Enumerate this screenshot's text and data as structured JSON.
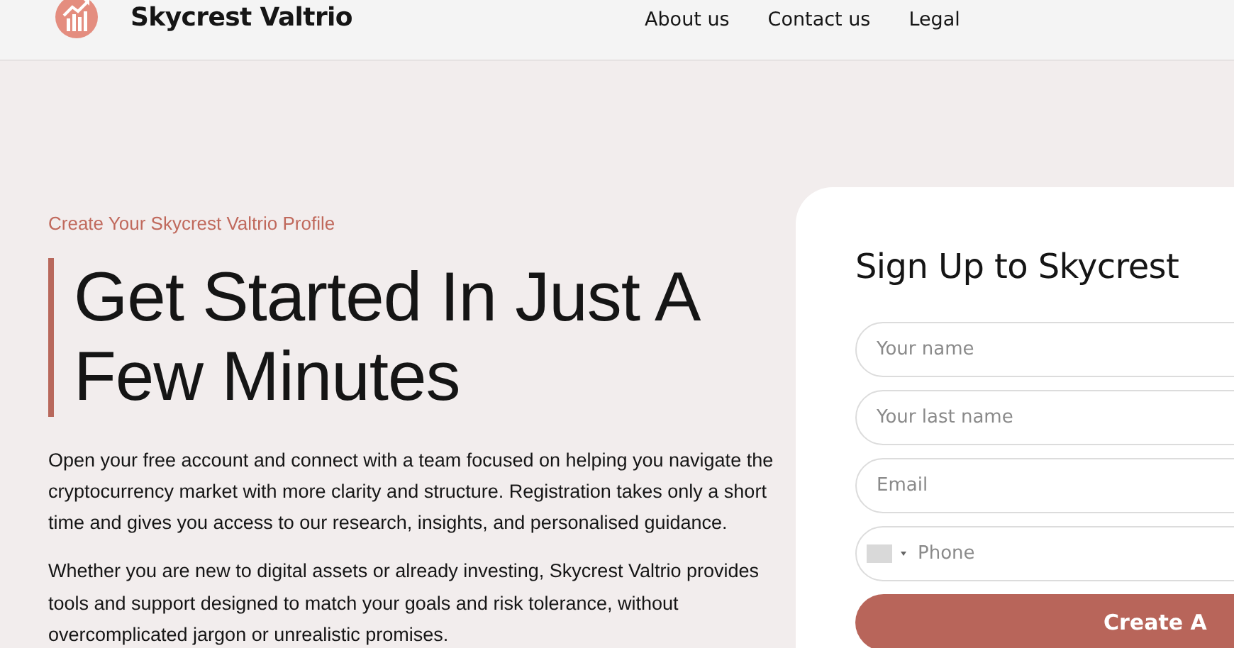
{
  "header": {
    "brand": "Skycrest Valtrio",
    "nav": [
      "About us",
      "Contact us",
      "Legal"
    ]
  },
  "hero": {
    "eyebrow": "Create Your Skycrest Valtrio Profile",
    "title": "Get Started In Just A Few Minutes",
    "paragraphs": [
      "Open your free account and connect with a team focused on helping you navigate the cryptocurrency market with more clarity and structure. Registration takes only a short time and gives you access to our research, insights, and personalised guidance.",
      "Whether you are new to digital assets or already investing, Skycrest Valtrio provides tools and support designed to match your goals and risk tolerance, without overcomplicated jargon or unrealistic promises."
    ]
  },
  "signup": {
    "title": "Sign Up to Skycrest",
    "fields": [
      {
        "kind": "text",
        "placeholder": "Your name"
      },
      {
        "kind": "text",
        "placeholder": "Your last name"
      },
      {
        "kind": "text",
        "placeholder": "Email"
      },
      {
        "kind": "phone",
        "placeholder": "Phone"
      }
    ],
    "submit": "Create A"
  }
}
